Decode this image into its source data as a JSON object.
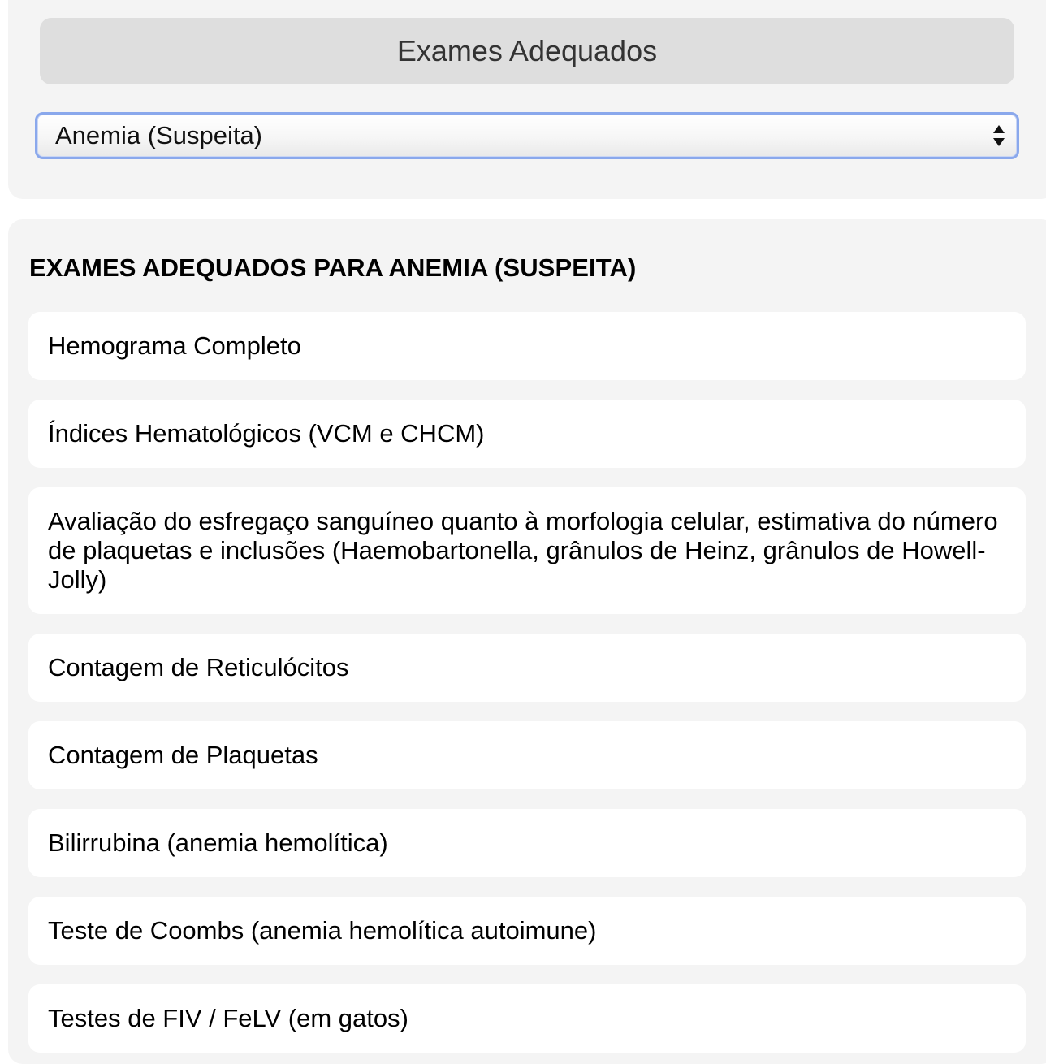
{
  "header": {
    "title": "Exames Adequados"
  },
  "selector": {
    "selected_value": "Anemia (Suspeita)"
  },
  "results": {
    "heading": "EXAMES ADEQUADOS PARA ANEMIA (SUSPEITA)",
    "items": [
      "Hemograma Completo",
      "Índices Hematológicos (VCM e CHCM)",
      "Avaliação do esfregaço sanguíneo quanto à morfologia celular, estimativa do número de plaquetas e inclusões (Haemobartonella, grânulos de Heinz, grânulos de Howell-Jolly)",
      "Contagem de Reticulócitos",
      "Contagem de Plaquetas",
      "Bilirrubina (anemia hemolítica)",
      "Teste de Coombs (anemia hemolítica autoimune)",
      "Testes de FIV / FeLV (em gatos)"
    ]
  },
  "colors": {
    "panel_background": "#f4f4f4",
    "title_button": "#dedede",
    "select_focus_border": "#8aa8ec",
    "item_background": "#ffffff"
  }
}
